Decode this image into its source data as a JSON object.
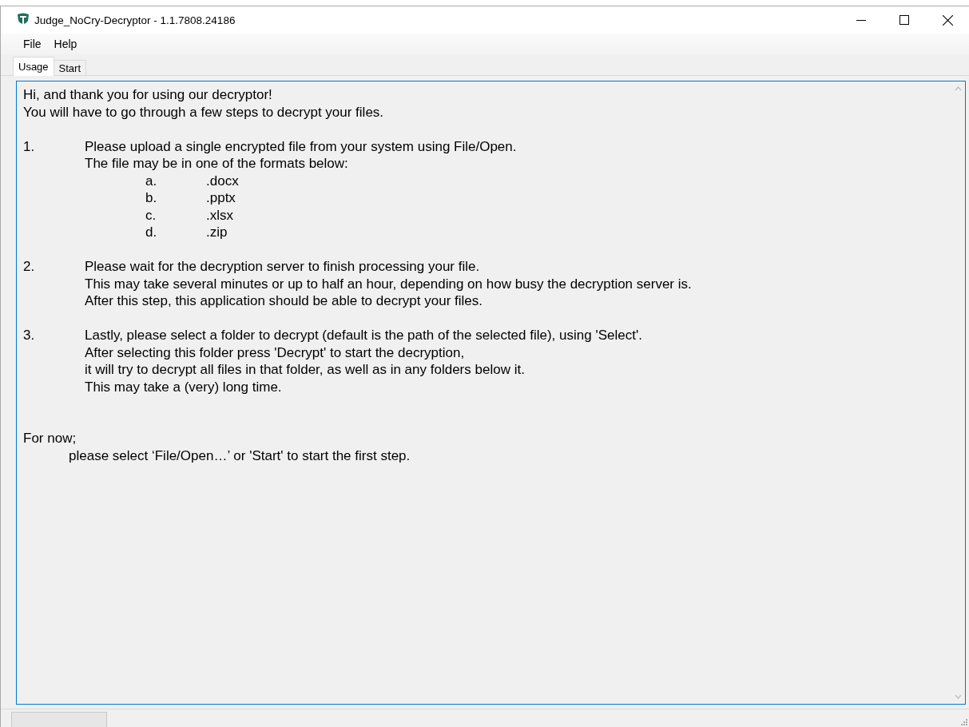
{
  "window": {
    "title": "Judge_NoCry-Decryptor - 1.1.7808.24186"
  },
  "menu": [
    "File",
    "Help"
  ],
  "tabs": [
    {
      "label": "Usage",
      "selected": true
    },
    {
      "label": "Start",
      "selected": false
    }
  ],
  "usage_text": {
    "intro": [
      "Hi, and thank you for using our decryptor!",
      "You will have to go through a few steps to decrypt your files."
    ],
    "steps": [
      {
        "number": "1.",
        "lines": [
          "Please upload a single encrypted file from your system using File/Open.",
          "The file may be in one of the formats below:"
        ],
        "items": [
          {
            "marker": "a.",
            "text": ".docx"
          },
          {
            "marker": "b.",
            "text": ".pptx"
          },
          {
            "marker": "c.",
            "text": ".xlsx"
          },
          {
            "marker": "d.",
            "text": ".zip"
          }
        ]
      },
      {
        "number": "2.",
        "lines": [
          "Please wait for the decryption server to finish processing your file.",
          "This may take several minutes or up to half an hour, depending on how busy the decryption server is.",
          "After this step, this application should be able to decrypt your files."
        ]
      },
      {
        "number": "3.",
        "lines": [
          "Lastly, please select a folder to decrypt (default is the path of the selected file), using 'Select'.",
          "After selecting this folder press 'Decrypt' to start the decryption,",
          "it will try to decrypt all files in that folder, as well as in any folders below it.",
          "This may take a (very) long time."
        ]
      }
    ],
    "outro": {
      "heading": "For now;",
      "text": "please select ‘File/Open…’ or 'Start' to start the first step."
    }
  }
}
